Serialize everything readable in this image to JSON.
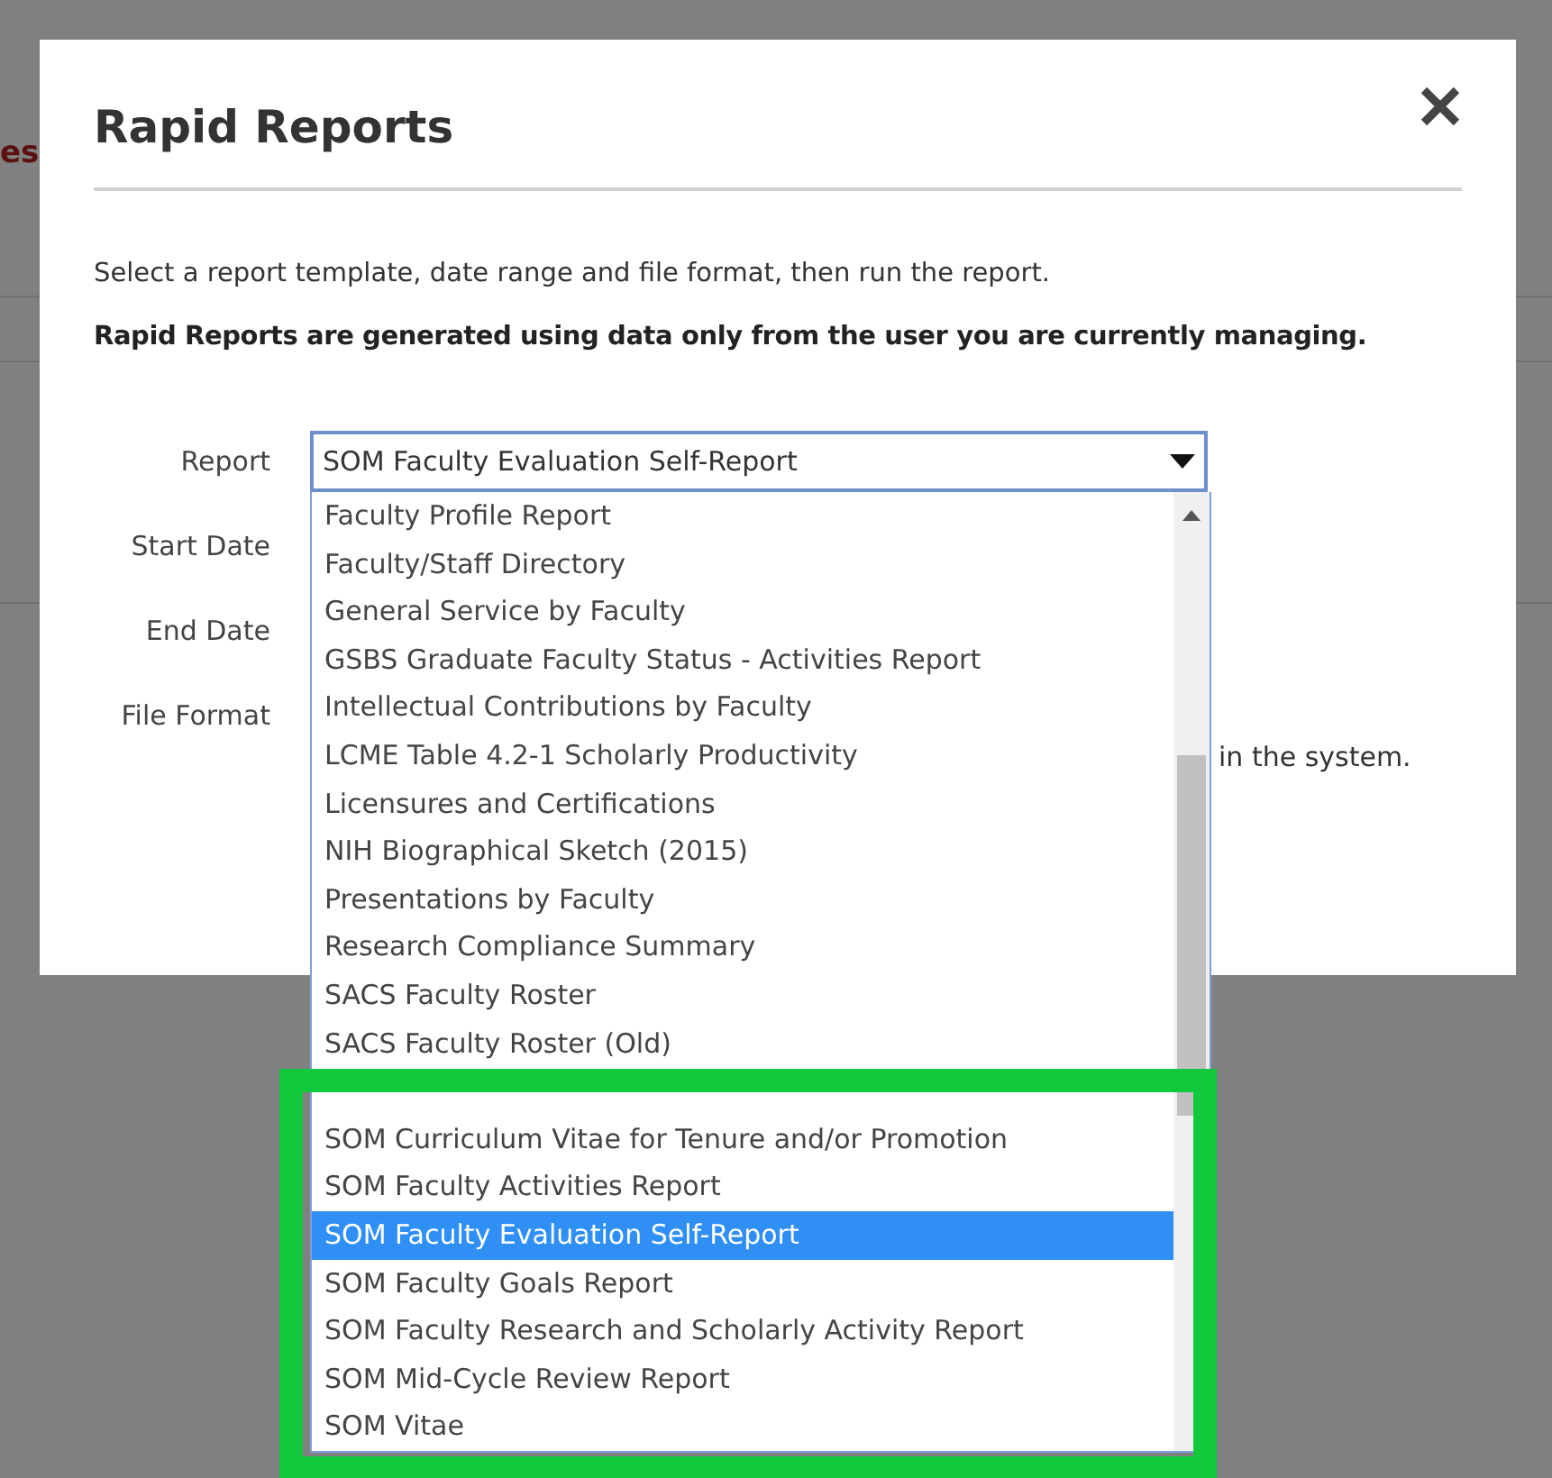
{
  "background_page": {
    "heading_fragment": "es"
  },
  "dialog": {
    "title": "Rapid Reports",
    "intro": "Select a report template, date range and file format, then run the report.",
    "notice": "Rapid Reports are generated using data only from the user you are currently managing.",
    "fields": [
      {
        "label": "Report",
        "kind": "select",
        "value": "SOM Faculty Evaluation Self-Report",
        "expanded": true
      },
      {
        "label": "Start Date",
        "kind": "date"
      },
      {
        "label": "End Date",
        "kind": "date"
      },
      {
        "label": "File Format",
        "kind": "format"
      }
    ],
    "note_fragment": "in the system.",
    "options": [
      {
        "label": "Faculty Profile Report",
        "selected": false
      },
      {
        "label": "Faculty/Staff Directory",
        "selected": false
      },
      {
        "label": "General Service by Faculty",
        "selected": false
      },
      {
        "label": "GSBS Graduate Faculty Status - Activities Report",
        "selected": false
      },
      {
        "label": "Intellectual Contributions by Faculty",
        "selected": false
      },
      {
        "label": "LCME Table 4.2-1 Scholarly Productivity",
        "selected": false
      },
      {
        "label": "Licensures and Certifications",
        "selected": false
      },
      {
        "label": "NIH Biographical Sketch (2015)",
        "selected": false
      },
      {
        "label": "Presentations by Faculty",
        "selected": false
      },
      {
        "label": "Research Compliance Summary",
        "selected": false
      },
      {
        "label": "SACS Faculty Roster",
        "selected": false
      },
      {
        "label": "SACS Faculty Roster (Old)",
        "selected": false
      }
    ],
    "highlight_box": {
      "options": [
        {
          "label": "SOM Curriculum Vitae for Tenure and/or Promotion",
          "selected": false
        },
        {
          "label": "SOM Faculty Activities Report",
          "selected": false
        },
        {
          "label": "SOM Faculty Evaluation Self-Report",
          "selected": true
        },
        {
          "label": "SOM Faculty Goals Report",
          "selected": false
        },
        {
          "label": "SOM Faculty Research and Scholarly Activity Report",
          "selected": false
        },
        {
          "label": "SOM Mid-Cycle Review Report",
          "selected": false
        },
        {
          "label": "SOM Vitae",
          "selected": false
        }
      ]
    }
  }
}
